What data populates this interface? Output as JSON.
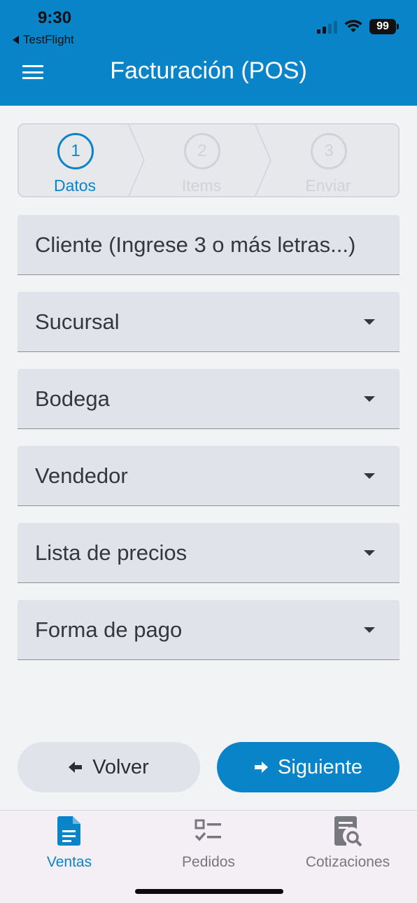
{
  "status_bar": {
    "time": "9:30",
    "back_app": "TestFlight",
    "battery": "99"
  },
  "header": {
    "title": "Facturación (POS)",
    "menu_icon": "hamburger-menu-icon",
    "background_color": "#0a84c9"
  },
  "stepper": {
    "steps": [
      {
        "number": "1",
        "label": "Datos",
        "active": true
      },
      {
        "number": "2",
        "label": "Items",
        "active": false
      },
      {
        "number": "3",
        "label": "Enviar",
        "active": false
      }
    ]
  },
  "form": {
    "cliente_placeholder": "Cliente (Ingrese 3 o más letras...)",
    "sucursal_label": "Sucursal",
    "bodega_label": "Bodega",
    "vendedor_label": "Vendedor",
    "lista_precios_label": "Lista de precios",
    "forma_pago_label": "Forma de pago"
  },
  "actions": {
    "back_label": "Volver",
    "next_label": "Siguiente"
  },
  "bottom_nav": {
    "items": [
      {
        "label": "Ventas",
        "icon": "document-icon",
        "active": true
      },
      {
        "label": "Pedidos",
        "icon": "checklist-icon",
        "active": false
      },
      {
        "label": "Cotizaciones",
        "icon": "document-search-icon",
        "active": false
      }
    ]
  },
  "colors": {
    "accent": "#0a84c9",
    "inactive": "#cfd2d8"
  }
}
